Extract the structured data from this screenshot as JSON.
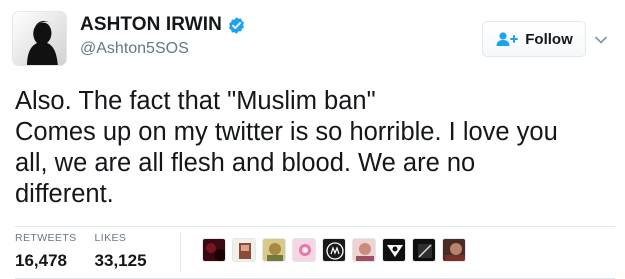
{
  "user": {
    "display_name": "ASHTON IRWIN",
    "handle": "@Ashton5SOS",
    "verified": true
  },
  "actions": {
    "follow_label": "Follow"
  },
  "tweet": {
    "text": "Also. The fact that \"Muslim ban\"\nComes up on my twitter is so horrible. I love you\nall, we are all flesh and blood. We are no\ndifferent."
  },
  "stats": {
    "retweets_label": "RETWEETS",
    "retweets_count": "16,478",
    "likes_label": "LIKES",
    "likes_count": "33,125"
  },
  "colors": {
    "verified_blue": "#1da1f2",
    "muted_text": "#657786",
    "border": "#e1e8ed"
  }
}
